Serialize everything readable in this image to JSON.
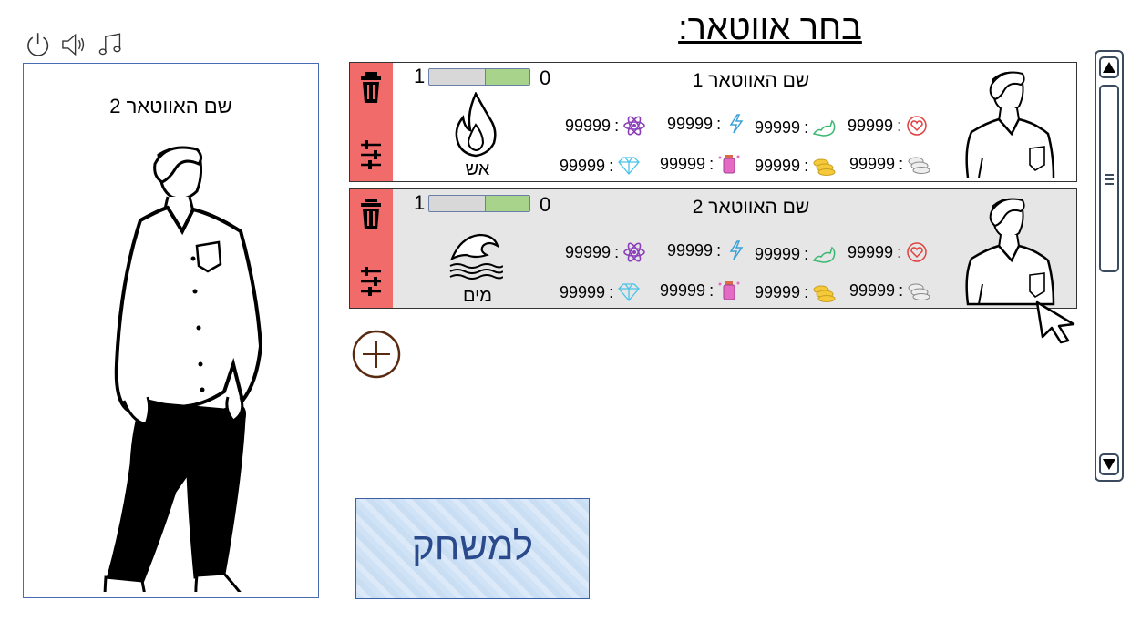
{
  "header": {
    "title": "בחר אווטאר:"
  },
  "top_icons": [
    "power-icon",
    "speaker-icon",
    "music-icon"
  ],
  "preview": {
    "avatar_name": "שם האווטאר 2"
  },
  "avatars": [
    {
      "name": "שם האווטאר 1",
      "level_left": "1",
      "level_right": "0",
      "progress": 0.45,
      "element": "אש",
      "element_icon": "fire-icon",
      "stats": {
        "heart": "99999",
        "strength": "99999",
        "energy": "99999",
        "magic": "99999",
        "coins_silver": "99999",
        "coins_gold": "99999",
        "potion": "99999",
        "gem": "99999"
      }
    },
    {
      "name": "שם האווטאר 2",
      "level_left": "1",
      "level_right": "0",
      "progress": 0.45,
      "element": "מים",
      "element_icon": "wave-icon",
      "stats": {
        "heart": "99999",
        "strength": "99999",
        "energy": "99999",
        "magic": "99999",
        "coins_silver": "99999",
        "coins_gold": "99999",
        "potion": "99999",
        "gem": "99999"
      }
    }
  ],
  "play_button": {
    "label": "למשחק"
  },
  "colors": {
    "side_strip": "#f26b6b",
    "progress_fill": "#a7d48a",
    "selected_card": "#e6e6e6",
    "play_text": "#2b4a8c"
  }
}
